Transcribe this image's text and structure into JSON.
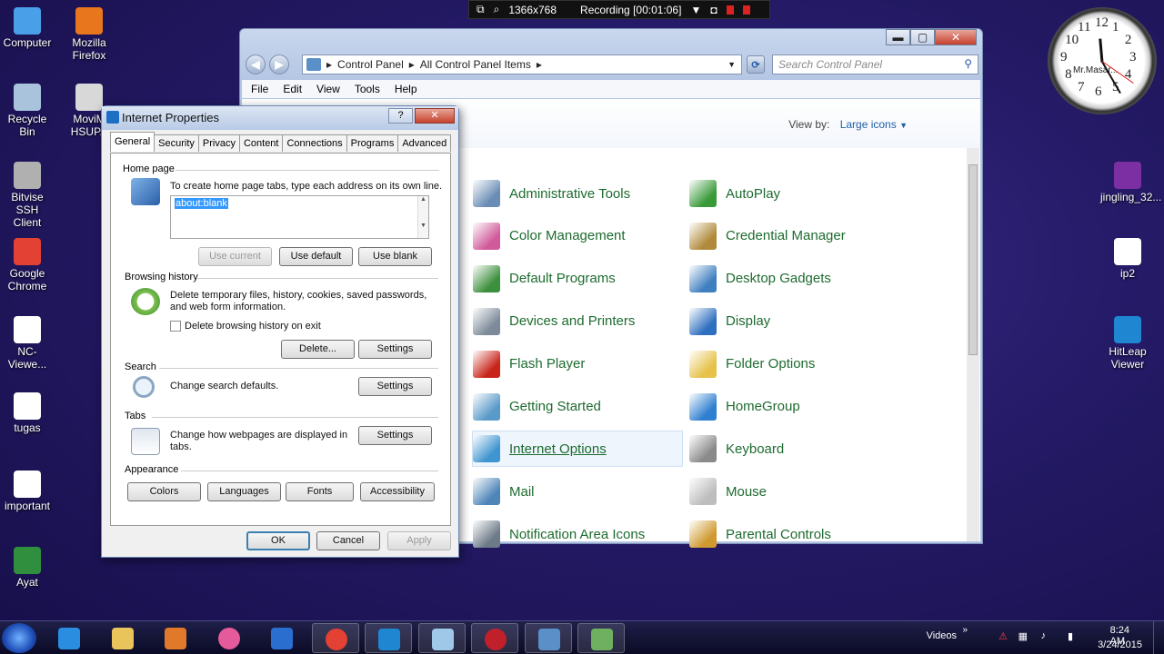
{
  "desktop_icons": [
    {
      "label": "Computer",
      "icon": "computer-icon",
      "color": "#4aa0e8"
    },
    {
      "label": "Mozilla\nFirefox",
      "icon": "firefox-icon",
      "color": "#e8761c"
    },
    {
      "label": "Recycle Bin",
      "icon": "recycle-bin-icon",
      "color": "#a9c3dc"
    },
    {
      "label": "MoviM\nHSUPA",
      "icon": "modem-icon",
      "color": "#d8d8d8"
    },
    {
      "label": "Bitvise SSH\nClient",
      "icon": "ssh-icon",
      "color": "#b0b0b0"
    },
    {
      "label": "Google\nChrome",
      "icon": "chrome-icon",
      "color": "#e34133"
    },
    {
      "label": "NC-Viewe...",
      "icon": "vnc-icon",
      "color": "#ffffff"
    },
    {
      "label": "tugas",
      "icon": "document-icon",
      "color": "#ffffff"
    },
    {
      "label": "important",
      "icon": "document-icon",
      "color": "#ffffff"
    },
    {
      "label": "Ayat",
      "icon": "shortcut-icon",
      "color": "#2f8f3f"
    },
    {
      "label": "jingling_32...",
      "icon": "archive-icon",
      "color": "#7b2fa3"
    },
    {
      "label": "ip2",
      "icon": "document-icon",
      "color": "#ffffff"
    },
    {
      "label": "HitLeap\nViewer",
      "icon": "hitleap-icon",
      "color": "#1f86d1"
    }
  ],
  "recorder": {
    "resolution": "1366x768",
    "status": "Recording [00:01:06]"
  },
  "clock_widget": {
    "brand": "Mr.Masar...",
    "numbers": [
      "12",
      "1",
      "2",
      "3",
      "4",
      "5",
      "6",
      "7",
      "8",
      "9",
      "10",
      "11"
    ]
  },
  "control_panel": {
    "breadcrumb": [
      "Control Panel",
      "All Control Panel Items"
    ],
    "search_placeholder": "Search Control Panel",
    "menu": [
      "File",
      "Edit",
      "View",
      "Tools",
      "Help"
    ],
    "view_by_label": "View by:",
    "view_by_value": "Large icons",
    "items": [
      {
        "label": "Administrative Tools",
        "icon": "admin-tools-icon",
        "color": "#6a8db5"
      },
      {
        "label": "AutoPlay",
        "icon": "autoplay-icon",
        "color": "#3a9a3a"
      },
      {
        "label": "Color Management",
        "icon": "color-management-icon",
        "color": "#d05a9a"
      },
      {
        "label": "Credential Manager",
        "icon": "credential-manager-icon",
        "color": "#b08a3a"
      },
      {
        "label": "Default Programs",
        "icon": "default-programs-icon",
        "color": "#3c8f3c"
      },
      {
        "label": "Desktop Gadgets",
        "icon": "desktop-gadgets-icon",
        "color": "#3f7fc0"
      },
      {
        "label": "Devices and Printers",
        "icon": "printer-icon",
        "color": "#7d8a99"
      },
      {
        "label": "Display",
        "icon": "display-icon",
        "color": "#2f6fbf"
      },
      {
        "label": "Flash Player",
        "icon": "flash-player-icon",
        "color": "#c8241a"
      },
      {
        "label": "Folder Options",
        "icon": "folder-options-icon",
        "color": "#e6c24a"
      },
      {
        "label": "Getting Started",
        "icon": "getting-started-icon",
        "color": "#5a9ac8"
      },
      {
        "label": "HomeGroup",
        "icon": "homegroup-icon",
        "color": "#2f7fd0"
      },
      {
        "label": "Internet Options",
        "icon": "internet-options-icon",
        "color": "#3f95d0"
      },
      {
        "label": "Keyboard",
        "icon": "keyboard-icon",
        "color": "#8a8a8a"
      },
      {
        "label": "Mail",
        "icon": "mail-icon",
        "color": "#4f86b8"
      },
      {
        "label": "Mouse",
        "icon": "mouse-icon",
        "color": "#bdbdbd"
      },
      {
        "label": "Notification Area Icons",
        "icon": "notification-icon",
        "color": "#6d7a88"
      },
      {
        "label": "Parental Controls",
        "icon": "parental-controls-icon",
        "color": "#d09a30"
      }
    ]
  },
  "dialog": {
    "title": "Internet Properties",
    "tabs": [
      "General",
      "Security",
      "Privacy",
      "Content",
      "Connections",
      "Programs",
      "Advanced"
    ],
    "home_page": {
      "heading": "Home page",
      "desc": "To create home page tabs, type each address on its own line.",
      "value": "about:blank",
      "use_current": "Use current",
      "use_default": "Use default",
      "use_blank": "Use blank"
    },
    "browsing_history": {
      "heading": "Browsing history",
      "desc": "Delete temporary files, history, cookies, saved passwords, and web form information.",
      "checkbox_label": "Delete browsing history on exit",
      "delete": "Delete...",
      "settings": "Settings"
    },
    "search": {
      "heading": "Search",
      "desc": "Change search defaults.",
      "settings": "Settings"
    },
    "tabs_group": {
      "heading": "Tabs",
      "desc": "Change how webpages are displayed in tabs.",
      "settings": "Settings"
    },
    "appearance": {
      "heading": "Appearance",
      "colors": "Colors",
      "languages": "Languages",
      "fonts": "Fonts",
      "accessibility": "Accessibility"
    },
    "ok": "OK",
    "cancel": "Cancel",
    "apply": "Apply"
  },
  "taskbar": {
    "pinned": [
      {
        "icon": "internet-explorer-icon",
        "color": "#2a8de0"
      },
      {
        "icon": "explorer-folder-icon",
        "color": "#e8c45a"
      },
      {
        "icon": "media-player-icon",
        "color": "#e07a2a"
      },
      {
        "icon": "osu-icon",
        "color": "#e45a9a"
      },
      {
        "icon": "maxthon-icon",
        "color": "#2a6fd0"
      },
      {
        "icon": "chrome-icon",
        "color": "#e34133"
      },
      {
        "icon": "hitleap-icon",
        "color": "#1f86d1"
      },
      {
        "icon": "notes-icon",
        "color": "#9ec7e8"
      },
      {
        "icon": "recorder-icon",
        "color": "#c0202a"
      },
      {
        "icon": "control-panel-icon",
        "color": "#5a8fc8"
      },
      {
        "icon": "internet-options-icon",
        "color": "#6fb060"
      }
    ],
    "videos_label": "Videos",
    "time": "8:24 AM",
    "date": "3/24/2015"
  }
}
